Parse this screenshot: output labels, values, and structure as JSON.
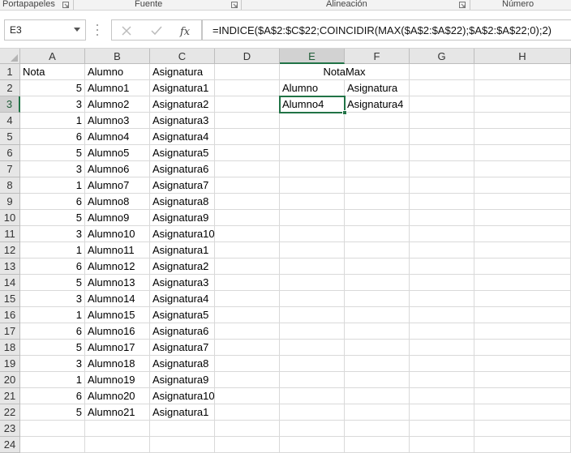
{
  "ribbon": {
    "groups": [
      {
        "label": "Portapapeles"
      },
      {
        "label": "Fuente"
      },
      {
        "label": "Alineación"
      },
      {
        "label": "Número"
      }
    ]
  },
  "formula_bar": {
    "name_box": "E3",
    "formula": "=INDICE($A$2:$C$22;COINCIDIR(MAX($A$2:$A$22);$A$2:$A$22;0);2)",
    "cancel_icon": "close-icon",
    "enter_icon": "check-icon",
    "function_icon": "fx-icon"
  },
  "sheet": {
    "columns": [
      "A",
      "B",
      "C",
      "D",
      "E",
      "F",
      "G",
      "H"
    ],
    "rows": [
      "1",
      "2",
      "3",
      "4",
      "5",
      "6",
      "7",
      "8",
      "9",
      "10",
      "11",
      "12",
      "13",
      "14",
      "15",
      "16",
      "17",
      "18",
      "19",
      "20",
      "21",
      "22",
      "23",
      "24"
    ],
    "header": {
      "nota": "Nota",
      "alumno": "Alumno",
      "asignatura": "Asignatura"
    },
    "data": [
      [
        "5",
        "Alumno1",
        "Asignatura1"
      ],
      [
        "3",
        "Alumno2",
        "Asignatura2"
      ],
      [
        "1",
        "Alumno3",
        "Asignatura3"
      ],
      [
        "6",
        "Alumno4",
        "Asignatura4"
      ],
      [
        "5",
        "Alumno5",
        "Asignatura5"
      ],
      [
        "3",
        "Alumno6",
        "Asignatura6"
      ],
      [
        "1",
        "Alumno7",
        "Asignatura7"
      ],
      [
        "6",
        "Alumno8",
        "Asignatura8"
      ],
      [
        "5",
        "Alumno9",
        "Asignatura9"
      ],
      [
        "3",
        "Alumno10",
        "Asignatura10"
      ],
      [
        "1",
        "Alumno11",
        "Asignatura1"
      ],
      [
        "6",
        "Alumno12",
        "Asignatura2"
      ],
      [
        "5",
        "Alumno13",
        "Asignatura3"
      ],
      [
        "3",
        "Alumno14",
        "Asignatura4"
      ],
      [
        "1",
        "Alumno15",
        "Asignatura5"
      ],
      [
        "6",
        "Alumno16",
        "Asignatura6"
      ],
      [
        "5",
        "Alumno17",
        "Asignatura7"
      ],
      [
        "3",
        "Alumno18",
        "Asignatura8"
      ],
      [
        "1",
        "Alumno19",
        "Asignatura9"
      ],
      [
        "6",
        "Alumno20",
        "Asignatura10"
      ],
      [
        "5",
        "Alumno21",
        "Asignatura1"
      ]
    ],
    "notamax": {
      "title": "NotaMax",
      "label_alumno": "Alumno",
      "label_asignatura": "Asignatura",
      "result_alumno": "Alumno4",
      "result_asignatura": "Asignatura4"
    },
    "active_cell": "E3"
  },
  "colors": {
    "accent": "#217346",
    "header_bg": "#e6e6e6",
    "gridline": "#d9d9d9"
  }
}
